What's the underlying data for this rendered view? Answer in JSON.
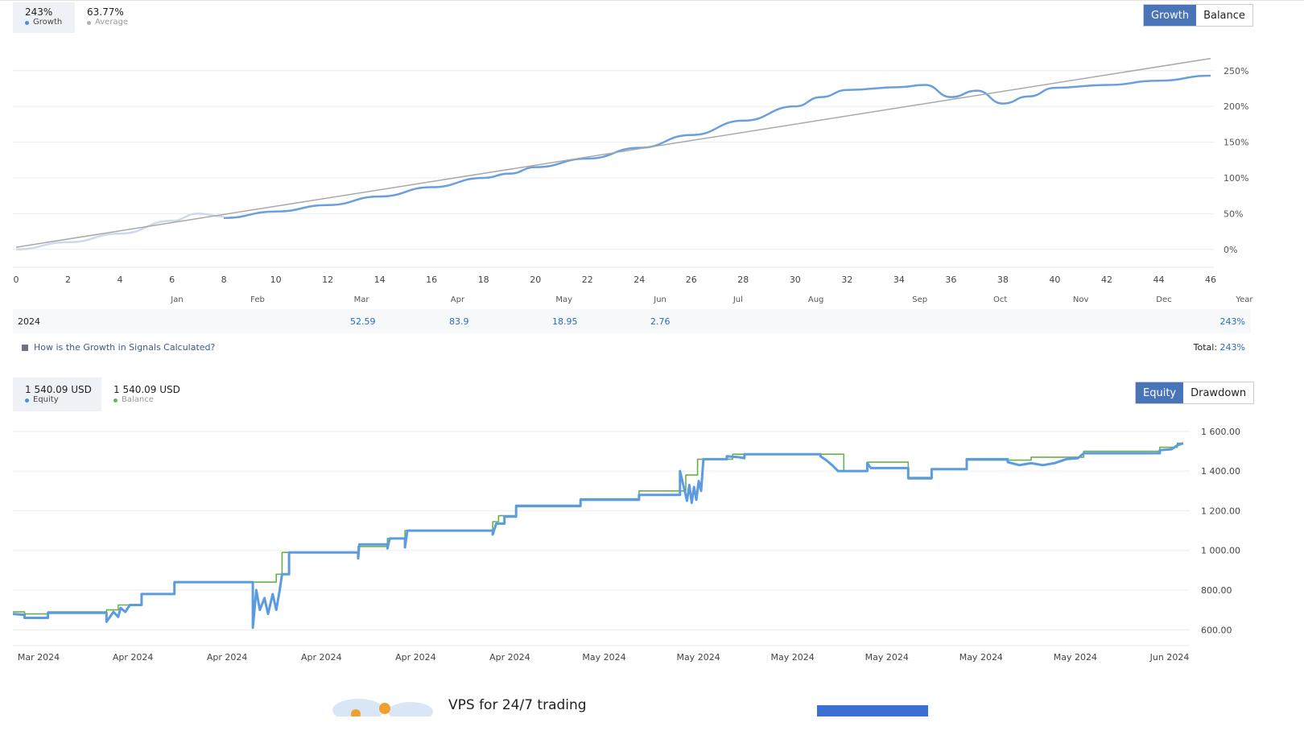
{
  "growth_panel": {
    "stats": [
      {
        "value": "243%",
        "label": "Growth",
        "color": "#4a90e2",
        "selected": true
      },
      {
        "value": "63.77%",
        "label": "Average",
        "color": "#b0b0b0",
        "selected": false
      }
    ],
    "buttons": [
      {
        "label": "Growth",
        "active": true
      },
      {
        "label": "Balance",
        "active": false
      }
    ]
  },
  "monthly": {
    "year": "2024",
    "values": [
      {
        "month": "Mar",
        "value": "52.59"
      },
      {
        "month": "Apr",
        "value": "83.9"
      },
      {
        "month": "May",
        "value": "18.95"
      },
      {
        "month": "Jun",
        "value": "2.76"
      }
    ],
    "year_total": "243%",
    "help_link": "How is the Growth in Signals Calculated?",
    "total_label": "Total:",
    "total_value": "243%"
  },
  "equity_panel": {
    "stats": [
      {
        "value": "1 540.09 USD",
        "label": "Equity",
        "color": "#4a90e2",
        "selected": true
      },
      {
        "value": "1 540.09 USD",
        "label": "Balance",
        "color": "#5cb85c",
        "selected": false
      }
    ],
    "buttons": [
      {
        "label": "Equity",
        "active": true
      },
      {
        "label": "Drawdown",
        "active": false
      }
    ]
  },
  "promo": {
    "title": "VPS for 24/7 trading"
  },
  "chart_data": [
    {
      "type": "line",
      "colors": {
        "growth": "#6a9fdd",
        "average": "#a9a9a9",
        "growth_faded": "#cfd9ea"
      },
      "x_ticks": [
        "0",
        "2",
        "4",
        "6",
        "8",
        "10",
        "12",
        "14",
        "16",
        "18",
        "20",
        "22",
        "24",
        "26",
        "28",
        "30",
        "32",
        "34",
        "36",
        "38",
        "40",
        "42",
        "44",
        "46"
      ],
      "xlim": [
        0,
        46
      ],
      "month_labels": [
        {
          "label": "Jan",
          "x": 6.2
        },
        {
          "label": "Feb",
          "x": 9.3
        },
        {
          "label": "Mar",
          "x": 13.3
        },
        {
          "label": "Apr",
          "x": 17
        },
        {
          "label": "May",
          "x": 21.1
        },
        {
          "label": "Jun",
          "x": 24.8
        },
        {
          "label": "Jul",
          "x": 27.8
        },
        {
          "label": "Aug",
          "x": 30.8
        },
        {
          "label": "Sep",
          "x": 34.8
        },
        {
          "label": "Oct",
          "x": 37.9
        },
        {
          "label": "Nov",
          "x": 41
        },
        {
          "label": "Dec",
          "x": 44.2
        },
        {
          "label": "Year",
          "x": 47.3
        }
      ],
      "y_ticks": [
        "0%",
        "50%",
        "100%",
        "150%",
        "200%",
        "250%"
      ],
      "y_tick_values": [
        0,
        50,
        100,
        150,
        200,
        250
      ],
      "ylim": [
        -25,
        270
      ],
      "series": [
        {
          "key": "growth_faded",
          "points": [
            [
              0,
              0
            ],
            [
              2,
              10
            ],
            [
              4,
              22
            ],
            [
              6,
              40
            ],
            [
              7,
              50
            ],
            [
              8,
              46
            ]
          ]
        },
        {
          "key": "growth",
          "points": [
            [
              8,
              44
            ],
            [
              10,
              53
            ],
            [
              12,
              62
            ],
            [
              14,
              74
            ],
            [
              16,
              87
            ],
            [
              18,
              100
            ],
            [
              19,
              106
            ],
            [
              20,
              115
            ],
            [
              22,
              127
            ],
            [
              24,
              142
            ],
            [
              26,
              160
            ],
            [
              28,
              180
            ],
            [
              30,
              200
            ],
            [
              31,
              213
            ],
            [
              32,
              223
            ],
            [
              34,
              227
            ],
            [
              35,
              230
            ],
            [
              36,
              213
            ],
            [
              37,
              222
            ],
            [
              38,
              204
            ],
            [
              39,
              214
            ],
            [
              40,
              226
            ],
            [
              42,
              230
            ],
            [
              44,
              236
            ],
            [
              46,
              243
            ]
          ]
        },
        {
          "key": "average",
          "points": [
            [
              0,
              3
            ],
            [
              46,
              267
            ]
          ]
        }
      ]
    },
    {
      "type": "line",
      "colors": {
        "equity": "#5b9be0",
        "balance": "#6ab04c"
      },
      "x_labels": [
        "Mar 2024",
        "Apr 2024",
        "Apr 2024",
        "Apr 2024",
        "Apr 2024",
        "Apr 2024",
        "May 2024",
        "May 2024",
        "May 2024",
        "May 2024",
        "May 2024",
        "May 2024",
        "Jun 2024"
      ],
      "xlim": [
        0,
        100
      ],
      "y_ticks": [
        "600.00",
        "800.00",
        "1 000.00",
        "1 200.00",
        "1 400.00",
        "1 600.00"
      ],
      "y_tick_values": [
        600,
        800,
        1000,
        1200,
        1400,
        1600
      ],
      "ylim": [
        520,
        1640
      ],
      "series": [
        {
          "key": "balance",
          "points": [
            [
              0,
              690
            ],
            [
              1,
              690
            ],
            [
              1,
              680
            ],
            [
              3,
              680
            ],
            [
              3,
              690
            ],
            [
              8,
              690
            ],
            [
              8,
              700
            ],
            [
              9,
              700
            ],
            [
              9,
              725
            ],
            [
              11,
              725
            ],
            [
              11,
              780
            ],
            [
              13.8,
              780
            ],
            [
              13.8,
              840
            ],
            [
              20.5,
              840
            ],
            [
              20.5,
              840
            ],
            [
              22.5,
              840
            ],
            [
              22.5,
              880
            ],
            [
              23,
              880
            ],
            [
              23,
              990
            ],
            [
              29.5,
              990
            ],
            [
              29.5,
              1020
            ],
            [
              32,
              1020
            ],
            [
              32,
              1060
            ],
            [
              33.5,
              1060
            ],
            [
              33.5,
              1100
            ],
            [
              41,
              1100
            ],
            [
              41,
              1145
            ],
            [
              41.5,
              1145
            ],
            [
              41.5,
              1175
            ],
            [
              43,
              1175
            ],
            [
              43,
              1220
            ],
            [
              48.5,
              1220
            ],
            [
              48.5,
              1260
            ],
            [
              53.5,
              1260
            ],
            [
              53.5,
              1300
            ],
            [
              57.5,
              1300
            ],
            [
              57.5,
              1380
            ],
            [
              58.5,
              1380
            ],
            [
              58.5,
              1460
            ],
            [
              61.5,
              1460
            ],
            [
              61.5,
              1485
            ],
            [
              69,
              1485
            ],
            [
              69,
              1485
            ],
            [
              71,
              1485
            ],
            [
              71,
              1400
            ],
            [
              73,
              1400
            ],
            [
              73,
              1445
            ],
            [
              76.5,
              1445
            ],
            [
              76.5,
              1360
            ],
            [
              78.5,
              1360
            ],
            [
              78.5,
              1410
            ],
            [
              81.5,
              1410
            ],
            [
              81.5,
              1455
            ],
            [
              87,
              1455
            ],
            [
              87,
              1470
            ],
            [
              91.5,
              1470
            ],
            [
              91.5,
              1500
            ],
            [
              98,
              1500
            ],
            [
              98,
              1520
            ],
            [
              99.5,
              1520
            ],
            [
              99.5,
              1540
            ],
            [
              100,
              1540
            ]
          ]
        },
        {
          "key": "equity",
          "points": [
            [
              0,
              680
            ],
            [
              1,
              675
            ],
            [
              1,
              660
            ],
            [
              3,
              660
            ],
            [
              3,
              685
            ],
            [
              8,
              685
            ],
            [
              8,
              640
            ],
            [
              8.6,
              690
            ],
            [
              9,
              665
            ],
            [
              9.2,
              710
            ],
            [
              9.6,
              690
            ],
            [
              10,
              725
            ],
            [
              11,
              725
            ],
            [
              11,
              780
            ],
            [
              13.8,
              780
            ],
            [
              13.8,
              840
            ],
            [
              20.5,
              840
            ],
            [
              20.5,
              610
            ],
            [
              20.8,
              800
            ],
            [
              21.1,
              700
            ],
            [
              21.5,
              760
            ],
            [
              21.8,
              680
            ],
            [
              22.2,
              780
            ],
            [
              22.5,
              700
            ],
            [
              22.8,
              800
            ],
            [
              23,
              880
            ],
            [
              23.6,
              880
            ],
            [
              23.6,
              990
            ],
            [
              29.5,
              990
            ],
            [
              29.5,
              960
            ],
            [
              29.6,
              1030
            ],
            [
              32,
              1030
            ],
            [
              32,
              1010
            ],
            [
              32.2,
              1060
            ],
            [
              33.5,
              1060
            ],
            [
              33.5,
              1015
            ],
            [
              33.7,
              1100
            ],
            [
              41,
              1100
            ],
            [
              41,
              1080
            ],
            [
              41.3,
              1135
            ],
            [
              42,
              1135
            ],
            [
              42,
              1170
            ],
            [
              43,
              1170
            ],
            [
              43,
              1225
            ],
            [
              48.5,
              1225
            ],
            [
              48.5,
              1255
            ],
            [
              53.5,
              1255
            ],
            [
              53.5,
              1280
            ],
            [
              57,
              1280
            ],
            [
              57,
              1400
            ],
            [
              57.4,
              1300
            ],
            [
              57.6,
              1250
            ],
            [
              57.8,
              1330
            ],
            [
              58,
              1240
            ],
            [
              58.2,
              1320
            ],
            [
              58.4,
              1255
            ],
            [
              58.6,
              1350
            ],
            [
              58.8,
              1300
            ],
            [
              59,
              1460
            ],
            [
              61,
              1460
            ],
            [
              61,
              1475
            ],
            [
              62,
              1470
            ],
            [
              62.5,
              1465
            ],
            [
              62.5,
              1485
            ],
            [
              69,
              1485
            ],
            [
              69,
              1475
            ],
            [
              69.5,
              1455
            ],
            [
              70,
              1430
            ],
            [
              70.5,
              1400
            ],
            [
              73,
              1400
            ],
            [
              73,
              1440
            ],
            [
              73.3,
              1415
            ],
            [
              76.5,
              1415
            ],
            [
              76.5,
              1365
            ],
            [
              78.5,
              1365
            ],
            [
              78.5,
              1410
            ],
            [
              81.5,
              1410
            ],
            [
              81.5,
              1460
            ],
            [
              85,
              1460
            ],
            [
              85,
              1445
            ],
            [
              86,
              1430
            ],
            [
              87,
              1440
            ],
            [
              88,
              1430
            ],
            [
              89,
              1440
            ],
            [
              90,
              1460
            ],
            [
              91,
              1465
            ],
            [
              91.5,
              1490
            ],
            [
              98,
              1490
            ],
            [
              98,
              1505
            ],
            [
              99,
              1510
            ],
            [
              99.5,
              1530
            ],
            [
              100,
              1540
            ],
            [
              100,
              1540
            ]
          ]
        }
      ]
    }
  ]
}
